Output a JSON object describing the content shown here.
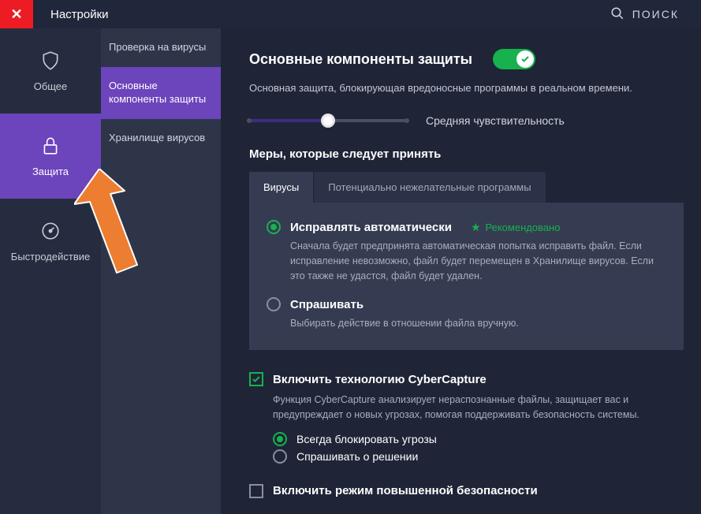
{
  "header": {
    "title": "Настройки",
    "search_label": "ПОИСК"
  },
  "nav1": {
    "items": [
      {
        "label": "Общее",
        "icon": "shield-icon"
      },
      {
        "label": "Защита",
        "icon": "lock-icon"
      },
      {
        "label": "Быстродействие",
        "icon": "gauge-icon"
      }
    ],
    "active_index": 1
  },
  "nav2": {
    "items": [
      {
        "label": "Проверка на вирусы"
      },
      {
        "label": "Основные компоненты защиты"
      },
      {
        "label": "Хранилище вирусов"
      }
    ],
    "active_index": 1
  },
  "main": {
    "title": "Основные компоненты защиты",
    "toggle_on": true,
    "description": "Основная защита, блокирующая вредоносные программы в реальном времени.",
    "slider": {
      "value_label": "Средняя чувствительность",
      "position_pct": 50
    },
    "measures_title": "Меры, которые следует принять",
    "tabs": [
      {
        "label": "Вирусы",
        "active": true
      },
      {
        "label": "Потенциально нежелательные программы",
        "active": false
      }
    ],
    "panel_options": [
      {
        "label": "Исправлять автоматически",
        "checked": true,
        "recommended_text": "Рекомендовано",
        "description": "Сначала будет предпринята автоматическая попытка исправить файл. Если исправление невозможно, файл будет перемещен в Хранилище вирусов. Если это также не удастся, файл будет удален."
      },
      {
        "label": "Спрашивать",
        "checked": false,
        "description": "Выбирать действие в отношении файла вручную."
      }
    ],
    "cybercapture": {
      "checked": true,
      "label": "Включить технологию CyberCapture",
      "description": "Функция CyberCapture анализирует нераспознанные файлы, защищает вас и предупреждает о новых угрозах, помогая поддерживать безопасность системы.",
      "options": [
        {
          "label": "Всегда блокировать угрозы",
          "checked": true
        },
        {
          "label": "Спрашивать о решении",
          "checked": false
        }
      ]
    },
    "hardened": {
      "checked": false,
      "label": "Включить режим повышенной безопасности"
    }
  }
}
